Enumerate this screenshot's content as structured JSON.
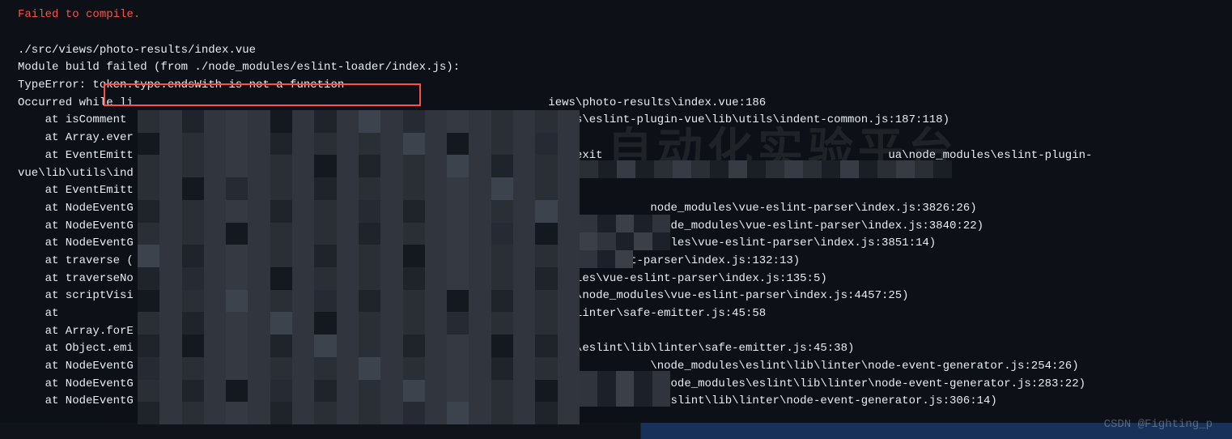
{
  "error_title": "Failed to compile.",
  "highlighted_error": "token.type.endsWith is not a function",
  "lines": [
    "./src/views/photo-results/index.vue",
    "Module build failed (from ./node_modules/eslint-loader/index.js):",
    "TypeError: token.type.endsWith is not a function",
    "Occurred while li                                                             iews\\photo-results\\index.vue:186",
    "    at isComment                                                              dules\\eslint-plugin-vue\\lib\\utils\\indent-common.js:187:118)",
    "    at Array.ever",
    "    at EventEmitt                                                              ]):exit                                          ua\\node_modules\\eslint-plugin-",
    "vue\\lib\\utils\\ind",
    "    at EventEmitt",
    "    at NodeEventG                                                                            node_modules\\vue-eslint-parser\\index.js:3826:26)",
    "    at NodeEventG                                                                            \\node_modules\\vue-eslint-parser\\index.js:3840:22)",
    "    at NodeEventG                                                                     \\node_modules\\vue-eslint-parser\\index.js:3851:14)",
    "    at traverse (                                                              s\\vue-eslint-parser\\index.js:132:13)",
    "    at traverseNo                                                              odules\\vue-eslint-parser\\index.js:135:5)",
    "    at scriptVisi                                                              hua\\node_modules\\vue-eslint-parser\\index.js:4457:25)",
    "    at                                                                         ib\\linter\\safe-emitter.js:45:58",
    "    at Array.forE",
    "    at Object.emi                                                              les\\eslint\\lib\\linter\\safe-emitter.js:45:38)",
    "    at NodeEventG                                                                            \\node_modules\\eslint\\lib\\linter\\node-event-generator.js:254:26)",
    "    at NodeEventG                                                                            a\\node_modules\\eslint\\lib\\linter\\node-event-generator.js:283:22)",
    "    at NodeEventG                                                              ua\\node_modules\\eslint\\lib\\linter\\node-event-generator.js:306:14)"
  ],
  "watermark_bg": "自动化实验平台",
  "watermark_footer": "CSDN @Fighting_p"
}
